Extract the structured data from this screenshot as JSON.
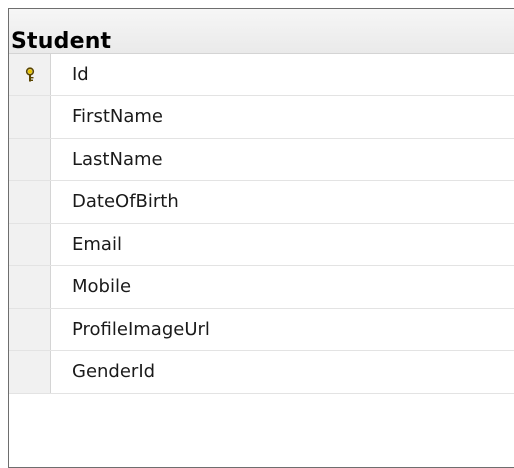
{
  "table": {
    "title": "Student",
    "columns": [
      {
        "name": "Id",
        "primary_key": true,
        "icon": "key-icon"
      },
      {
        "name": "FirstName",
        "primary_key": false
      },
      {
        "name": "LastName",
        "primary_key": false
      },
      {
        "name": "DateOfBirth",
        "primary_key": false
      },
      {
        "name": "Email",
        "primary_key": false
      },
      {
        "name": "Mobile",
        "primary_key": false
      },
      {
        "name": "ProfileImageUrl",
        "primary_key": false
      },
      {
        "name": "GenderId",
        "primary_key": false
      }
    ]
  },
  "colors": {
    "border": "#6e6e6e",
    "header_bg": "#eeeeee",
    "selector_bg": "#f1f1f1",
    "key_icon": "#c9a200"
  }
}
